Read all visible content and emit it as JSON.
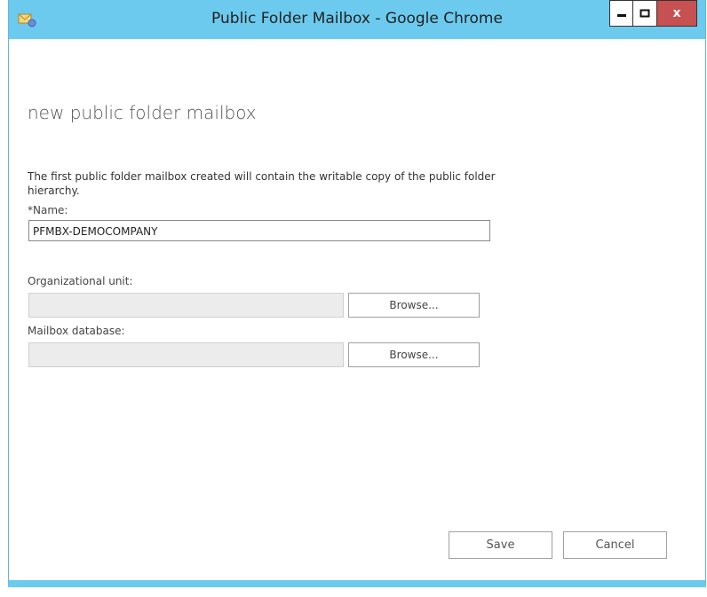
{
  "window": {
    "title": "Public Folder Mailbox - Google Chrome",
    "controls": {
      "minimize": "minimize",
      "maximize": "maximize",
      "close": "x"
    }
  },
  "form": {
    "heading": "new public folder mailbox",
    "description": "The first public folder mailbox created will contain the writable copy of the public folder hierarchy.",
    "name_label": "*Name:",
    "name_value": "PFMBX-DEMOCOMPANY",
    "ou_label": "Organizational unit:",
    "ou_value": "",
    "ou_browse": "Browse...",
    "db_label": "Mailbox database:",
    "db_value": "",
    "db_browse": "Browse..."
  },
  "footer": {
    "save": "Save",
    "cancel": "Cancel"
  },
  "colors": {
    "titlebar": "#6ccaee",
    "close_button": "#c75050"
  }
}
